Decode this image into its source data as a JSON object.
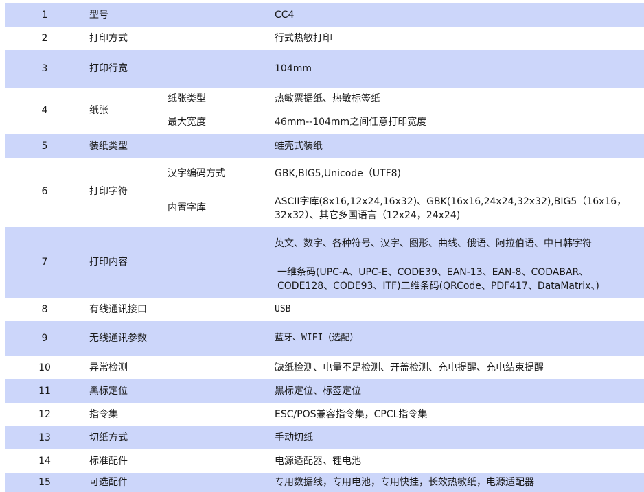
{
  "rows": [
    {
      "num": "1",
      "item": "型号",
      "value": "CC4"
    },
    {
      "num": "2",
      "item": "打印方式",
      "value": "行式热敏打印"
    },
    {
      "num": "3",
      "item": "打印行宽",
      "value": "104mm"
    },
    {
      "num": "4",
      "item": "纸张",
      "subitems": [
        {
          "label": "纸张类型",
          "value": "热敏票据纸、热敏标签纸"
        },
        {
          "label": "最大宽度",
          "value": "46mm--104mm之间任意打印宽度"
        }
      ]
    },
    {
      "num": "5",
      "item": "装纸类型",
      "value": "蛙壳式装纸"
    },
    {
      "num": "6",
      "item": "打印字符",
      "subitems": [
        {
          "label": "汉字编码方式",
          "value": "GBK,BIG5,Unicode（UTF8)"
        },
        {
          "label": "内置字库",
          "value": "ASCII字库(8x16,12x24,16x32)、GBK(16x16,24x24,32x32),BIG5（16x16，32x32）、其它多国语言（12x24，24x24)"
        }
      ]
    },
    {
      "num": "7",
      "item": "打印内容",
      "values": [
        "英文、数字、各种符号、汉字、图形、曲线、俄语、阿拉伯语、中日韩字符",
        "一维条码(UPC-A、UPC-E、CODE39、EAN-13、EAN-8、CODABAR、CODE128、CODE93、ITF)二维条码(QRCode、PDF417、DataMatrix、)"
      ]
    },
    {
      "num": "8",
      "item": "有线通讯接口",
      "value": "USB"
    },
    {
      "num": "9",
      "item": "无线通讯参数",
      "value": "蓝牙、WIFI（选配）"
    },
    {
      "num": "10",
      "item": "异常检测",
      "value": "缺纸检测、电量不足检测、开盖检测、充电提醒、充电结束提醒"
    },
    {
      "num": "11",
      "item": "黑标定位",
      "value": "黑标定位、标签定位"
    },
    {
      "num": "12",
      "item": "指令集",
      "value": "ESC/POS兼容指令集，CPCL指令集"
    },
    {
      "num": "13",
      "item": "切纸方式",
      "value": "手动切纸"
    },
    {
      "num": "14",
      "item": "标准配件",
      "value": "电源适配器、锂电池"
    },
    {
      "num": "15",
      "item": "可选配件",
      "value": "专用数据线，专用电池，专用快挂，长效热敏纸，电源适配器"
    }
  ],
  "colors": {
    "shaded_row": "#ccd6fa",
    "plain_row": "#ffffff",
    "text": "#1a1a1a"
  }
}
